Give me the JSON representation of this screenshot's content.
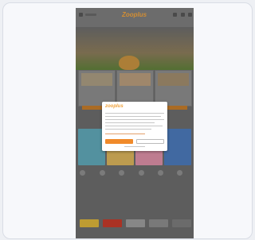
{
  "header": {
    "logo_text": "Zooplus"
  },
  "colors": {
    "brand_orange": "#f08a2a",
    "dim_overlay": "#6a6a6a"
  },
  "icons": [
    "menu-icon",
    "search-icon",
    "account-icon",
    "cart-icon"
  ],
  "consent_modal": {
    "logo_text": "zooplus"
  }
}
